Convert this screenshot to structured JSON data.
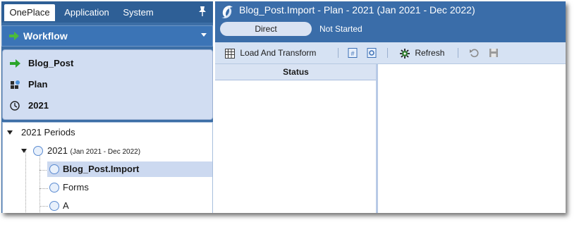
{
  "left": {
    "tabs": [
      "OnePlace",
      "Application",
      "System"
    ],
    "workflow_label": "Workflow",
    "pov": [
      {
        "icon": "green-arrow-icon",
        "label": "Blog_Post"
      },
      {
        "icon": "scenario-icon",
        "label": "Plan"
      },
      {
        "icon": "clock-icon",
        "label": "2021"
      }
    ],
    "tree": {
      "root": "2021 Periods",
      "child_label": "2021",
      "child_range": "(Jan 2021 - Dec 2022)",
      "items": [
        "Blog_Post.Import",
        "Forms",
        "A"
      ]
    }
  },
  "right": {
    "title": "Blog_Post.Import  -  Plan  -  2021 (Jan 2021 - Dec 2022)",
    "pill": "Direct",
    "status": "Not Started",
    "toolbar": {
      "load_label": "Load And Transform",
      "refresh_label": "Refresh"
    },
    "grid_header": "Status"
  },
  "colors": {
    "header_blue": "#3a6da9",
    "pov_bg": "#d1ddf2",
    "selection": "#ccd9f0"
  }
}
